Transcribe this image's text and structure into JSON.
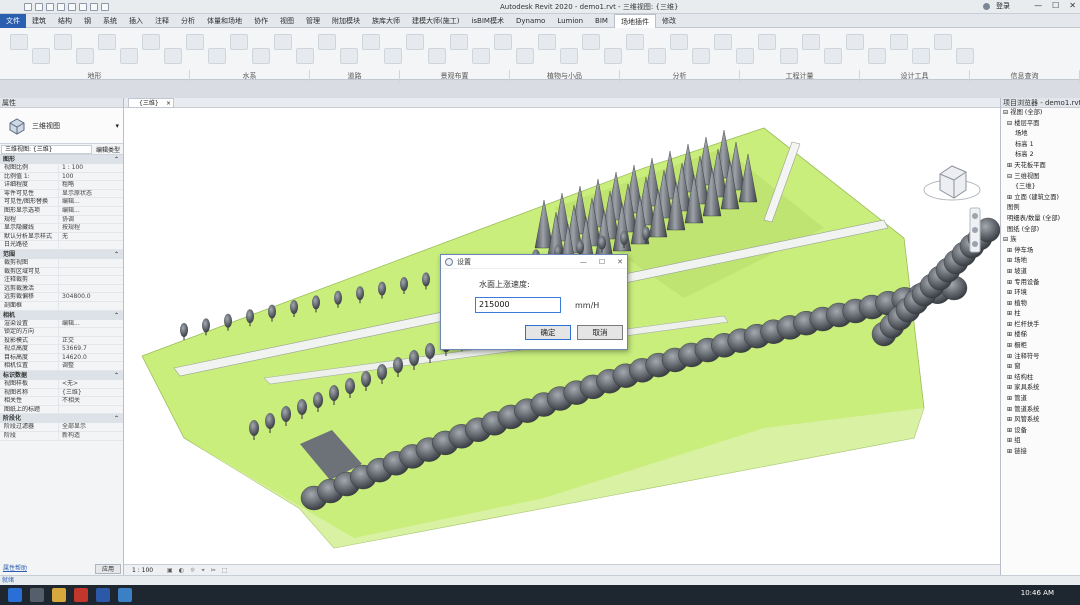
{
  "app": {
    "title": "Autodesk Revit 2020 - demo1.rvt - 三维视图: {三维}",
    "user": "登录",
    "window_controls": [
      "—",
      "☐",
      "✕"
    ]
  },
  "menu": {
    "items": [
      "文件",
      "建筑",
      "结构",
      "钢",
      "系统",
      "插入",
      "注释",
      "分析",
      "体量和场地",
      "协作",
      "视图",
      "管理",
      "附加模块",
      "族库大师",
      "建模大师(施工)",
      "isBIM模术",
      "Dynamo",
      "Lumion",
      "BIM",
      "场地插件",
      "修改"
    ],
    "active": "场地插件"
  },
  "ribbon": {
    "groups": [
      "地形",
      "水系",
      "道路",
      "景观布置",
      "植物与小品",
      "分析",
      "工程计量",
      "设计工具",
      "信息查询"
    ]
  },
  "properties": {
    "header": "属性",
    "type_name": "三维视图",
    "view_selector": "三维视图: {三维}",
    "edit_type": "编辑类型",
    "sections": [
      {
        "title": "图形",
        "rows": [
          [
            "视图比例",
            "1 : 100"
          ],
          [
            "比例值 1:",
            "100"
          ],
          [
            "详细程度",
            "粗略"
          ],
          [
            "零件可见性",
            "显示原状态"
          ],
          [
            "可见性/图形替换",
            "编辑..."
          ],
          [
            "图形显示选项",
            "编辑..."
          ],
          [
            "规程",
            "协调"
          ],
          [
            "显示隐藏线",
            "按规程"
          ],
          [
            "默认分析显示样式",
            "无"
          ],
          [
            "日光路径",
            ""
          ]
        ]
      },
      {
        "title": "范围",
        "rows": [
          [
            "裁剪视图",
            ""
          ],
          [
            "裁剪区域可见",
            ""
          ],
          [
            "注释裁剪",
            ""
          ],
          [
            "远剪裁激活",
            ""
          ],
          [
            "远剪裁偏移",
            "304800.0"
          ],
          [
            "剖面框",
            ""
          ]
        ]
      },
      {
        "title": "相机",
        "rows": [
          [
            "渲染设置",
            "编辑..."
          ],
          [
            "锁定的方向",
            ""
          ],
          [
            "投影模式",
            "正交"
          ],
          [
            "视点高度",
            "53669.7"
          ],
          [
            "目标高度",
            "14620.0"
          ],
          [
            "相机位置",
            "调整"
          ]
        ]
      },
      {
        "title": "标识数据",
        "rows": [
          [
            "视图样板",
            "<无>"
          ],
          [
            "视图名称",
            "{三维}"
          ],
          [
            "相关性",
            "不相关"
          ],
          [
            "图纸上的标题",
            ""
          ]
        ]
      },
      {
        "title": "阶段化",
        "rows": [
          [
            "阶段过滤器",
            "全部显示"
          ],
          [
            "阶段",
            "新构造"
          ]
        ]
      }
    ],
    "help_link": "属性帮助",
    "apply": "应用"
  },
  "view_tab": {
    "label": "{三维}"
  },
  "view_bar": {
    "scale": "1 : 100"
  },
  "dialog": {
    "title": "设置",
    "prompt": "水面上涨速度:",
    "value": "215000",
    "unit": "mm/H",
    "ok": "确定",
    "cancel": "取消"
  },
  "browser": {
    "header": "项目浏览器 - demo1.rvt",
    "items": [
      "⊟ 视图 (全部)",
      "  ⊟ 楼层平面",
      "      场地",
      "      标高 1",
      "      标高 2",
      "  ⊞ 天花板平面",
      "  ⊟ 三维视图",
      "      {三维}",
      "  ⊞ 立面 (建筑立面)",
      "  图例",
      "  明细表/数量 (全部)",
      "  图纸 (全部)",
      "⊟ 族",
      "  ⊞ 停车场",
      "  ⊞ 场地",
      "  ⊞ 坡道",
      "  ⊞ 专用设备",
      "  ⊞ 环境",
      "  ⊞ 植物",
      "  ⊞ 柱",
      "  ⊞ 栏杆扶手",
      "  ⊞ 楼梯",
      "  ⊞ 橱柜",
      "  ⊞ 注释符号",
      "  ⊞ 窗",
      "  ⊞ 结构柱",
      "  ⊞ 家具系统",
      "  ⊞ 管道",
      "  ⊞ 管道系统",
      "  ⊞ 风管系统",
      "  ⊞ 设备",
      "  ⊞ 组",
      "  ⊞ 链接"
    ]
  },
  "status": {
    "text": "就绪"
  },
  "taskbar": {
    "time": "10:46 AM"
  }
}
